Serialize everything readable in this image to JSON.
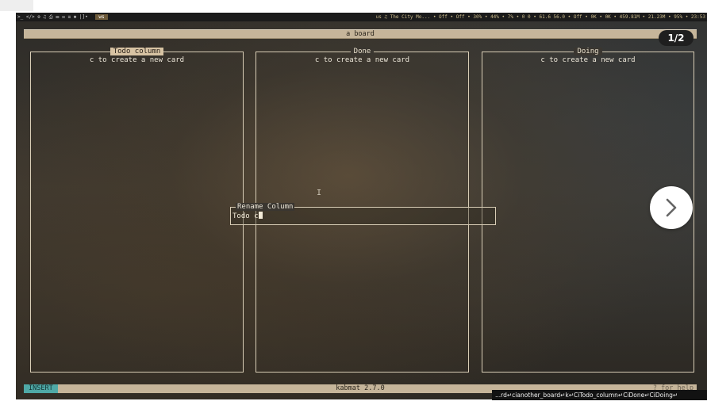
{
  "topbar": {
    "workspaces": ">_  </>  ⊕  ♫  ⎙  ☰  ✉  ≡  ✱  |]•",
    "active_workspace": "ws",
    "status_right": "us  ♫ The City Mo...  • Off  • Off  • 30%  • 44%  • 7%  • 0 0  • 61.6 56.0  • Off  • 0K • 0K  • 459.81M • 21.23M  • 95%  • 23:53"
  },
  "board": {
    "title": "a board",
    "columns": [
      {
        "title": "Todo column",
        "hint": "c to create a new card",
        "active": true
      },
      {
        "title": "Done",
        "hint": "c to create a new card",
        "active": false
      },
      {
        "title": "Doing",
        "hint": "c to create a new card",
        "active": false
      }
    ]
  },
  "rename_dialog": {
    "label": "Rename Column",
    "value": "Todo c"
  },
  "statusbar": {
    "mode": "INSERT",
    "version": "kabmat 2.7.0",
    "help": "? for help"
  },
  "keylog": "...rd↵cianother_board↵k↵CiTodo_column↵CiDone↵CiDoing↵",
  "viewer": {
    "page_counter": "1/2"
  },
  "colors": {
    "panel_border": "#d8cdb6",
    "title_bar": "#c6b59a",
    "mode_badge": "#4fa9a7"
  }
}
